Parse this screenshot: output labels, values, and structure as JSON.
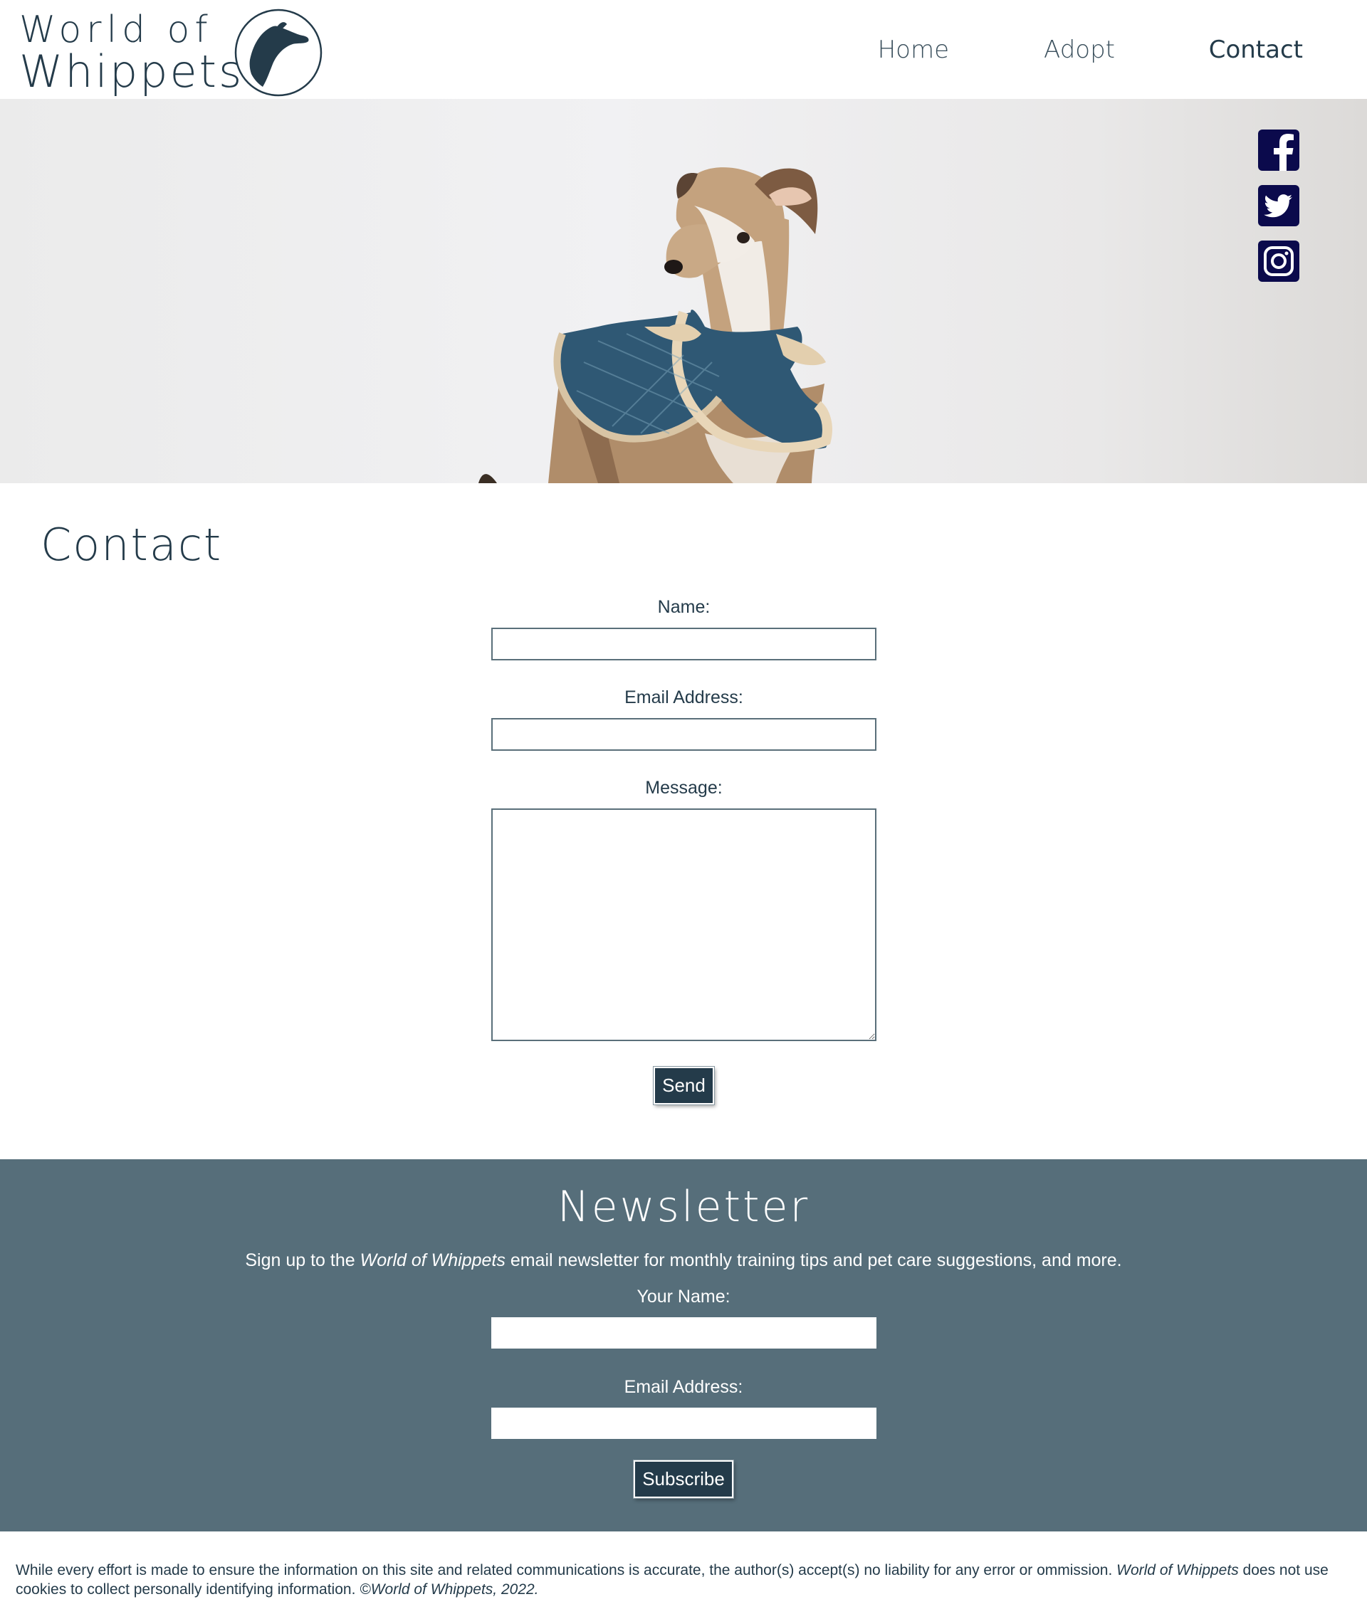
{
  "header": {
    "logo_line1": "World of",
    "logo_line2": "Whippets",
    "nav": [
      {
        "label": "Home",
        "active": false
      },
      {
        "label": "Adopt",
        "active": false
      },
      {
        "label": "Contact",
        "active": true
      }
    ]
  },
  "hero": {
    "social_icons": [
      "facebook-icon",
      "twitter-icon",
      "instagram-icon"
    ],
    "icon_color": "#0b0a4c"
  },
  "contact": {
    "title": "Contact",
    "name_label": "Name:",
    "name_value": "",
    "email_label": "Email Address:",
    "email_value": "",
    "message_label": "Message:",
    "message_value": "",
    "send_label": "Send"
  },
  "newsletter": {
    "title": "Newsletter",
    "intro_prefix": "Sign up to the",
    "intro_brand": "World of Whippets",
    "intro_suffix": "email newsletter for monthly training tips and pet care suggestions, and more.",
    "name_label": "Your Name:",
    "name_value": "",
    "email_label": "Email Address:",
    "email_value": "",
    "subscribe_label": "Subscribe"
  },
  "footer": {
    "disclaimer": "While every effort is made to ensure the information on this site and related communications is accurate, the author(s) accept(s) no liability for any error or ommission.",
    "brand": "World of Whippets",
    "cookies": "does not use cookies to collect personally identifying information.",
    "copyright": "©World of Whippets, 2022."
  },
  "colors": {
    "primary_dark": "#243b4a",
    "newsletter_bg": "#566e7a",
    "social_icon": "#0b0a4c"
  }
}
